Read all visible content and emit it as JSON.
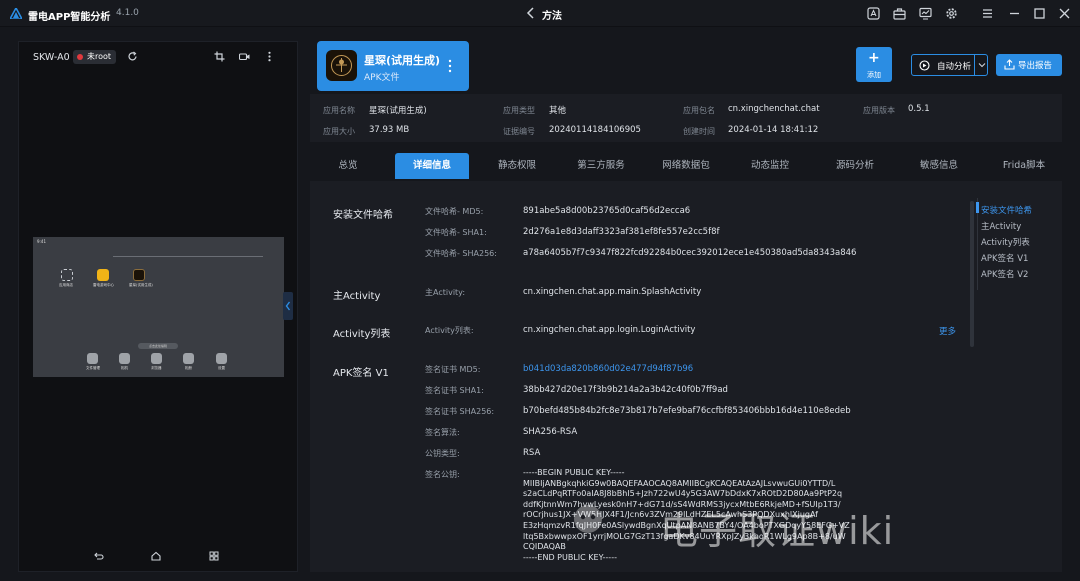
{
  "app": {
    "title": "雷电APP智能分析",
    "version": "4.1.0"
  },
  "titlebar": {
    "center_title": "方法"
  },
  "device": {
    "name": "SKW-A0",
    "root_label": "未root",
    "screen": {
      "time": "9:41",
      "apps": [
        {
          "label": "应用商店"
        },
        {
          "label": "雷电游戏中心"
        },
        {
          "label": "星琛(试用生成)"
        }
      ],
      "dock": [
        "文件管理",
        "相机",
        "浏览器",
        "相册",
        "设置"
      ],
      "pill": "点击此处编辑"
    }
  },
  "app_card": {
    "name": "星琛(试用生成)",
    "type": "APK文件"
  },
  "actions": {
    "add": "添加",
    "auto": "自动分析",
    "export": "导出报告"
  },
  "info": {
    "app_name_k": "应用名称",
    "app_name_v": "星琛(试用生成)",
    "app_type_k": "应用类型",
    "app_type_v": "其他",
    "pkg_k": "应用包名",
    "pkg_v": "cn.xingchenchat.chat",
    "ver_k": "应用版本",
    "ver_v": "0.5.1",
    "size_k": "应用大小",
    "size_v": "37.93 MB",
    "evid_k": "证据编号",
    "evid_v": "20240114184106905",
    "ctime_k": "创建时间",
    "ctime_v": "2024-01-14 18:41:12"
  },
  "tabs": [
    "总览",
    "详细信息",
    "静态权限",
    "第三方服务",
    "网络数据包",
    "动态监控",
    "源码分析",
    "敏感信息",
    "Frida脚本"
  ],
  "details": {
    "hash_title": "安装文件哈希",
    "md5_k": "文件哈希- MD5:",
    "md5_v": "891abe5a8d00b23765d0caf56d2ecca6",
    "sha1_k": "文件哈希- SHA1:",
    "sha1_v": "2d276a1e8d3daff3323af381ef8fe557e2cc5f8f",
    "sha256_k": "文件哈希- SHA256:",
    "sha256_v": "a78a6405b7f7c9347f822fcd92284b0cec392012ece1e450380ad5da8343a846",
    "main_title": "主Activity",
    "main_k": "主Activity:",
    "main_v": "cn.xingchen.chat.app.main.SplashActivity",
    "list_title": "Activity列表",
    "list_k": "Activity列表:",
    "list_v": "cn.xingchen.chat.app.login.LoginActivity",
    "more": "更多",
    "v1_title": "APK签名 V1",
    "cmd5_k": "签名证书 MD5:",
    "cmd5_v": "b041d03da820b860d02e477d94f87b96",
    "csha1_k": "签名证书 SHA1:",
    "csha1_v": "38bb427d20e17f3b9b214a2a3b42c40f0b7ff9ad",
    "csha256_k": "签名证书 SHA256:",
    "csha256_v": "b70befd485b84b2fc8e73b817b7efe9baf76ccfbf853406bbb16d4e110e8edeb",
    "alg_k": "签名算法:",
    "alg_v": "SHA256-RSA",
    "ktype_k": "公钥类型:",
    "ktype_v": "RSA",
    "pk_k": "签名公钥:",
    "pk_v": "-----BEGIN PUBLIC KEY-----\nMIIBIjANBgkqhkiG9w0BAQEFAAOCAQ8AMIIBCgKCAQEAtAzAJLsvwuGUi0YTTD/L\ns2aCLdPqRTFo0aIA8J8bBhI5+Jzh722wU4y5G3AW7bDdxK7xROtD2D80Aa9PtP2q\nddfKjtnnWm7hvwLyesk0nH7+dG71d/sS4WdRMS3jycxMtbE6RkjeMD+fSUIp1T3/\nrOCrjhus1JX+VW5HJX4F1/Jcn6v3ZVm29lLdHZEL5cAwhS3PQDXuxhlXjugAf\nE3zHqmzvR1fqJH0Fe0ASlywdBgnXqUtpAN8ANB7BY4/OA4boPTXGDqyY58EFG+VZ\nltq5BxbwwpxOF1yrrjMOLG7GzT13fgaDKv84UuYRXpJZy3khoR1WLg9Ap8B+8/uW\nCQIDAQAB\n-----END PUBLIC KEY-----"
  },
  "anchors": [
    "安装文件哈希",
    "主Activity",
    "Activity列表",
    "APK签名 V1",
    "APK签名 V2"
  ],
  "watermark": "电子取证wiki"
}
